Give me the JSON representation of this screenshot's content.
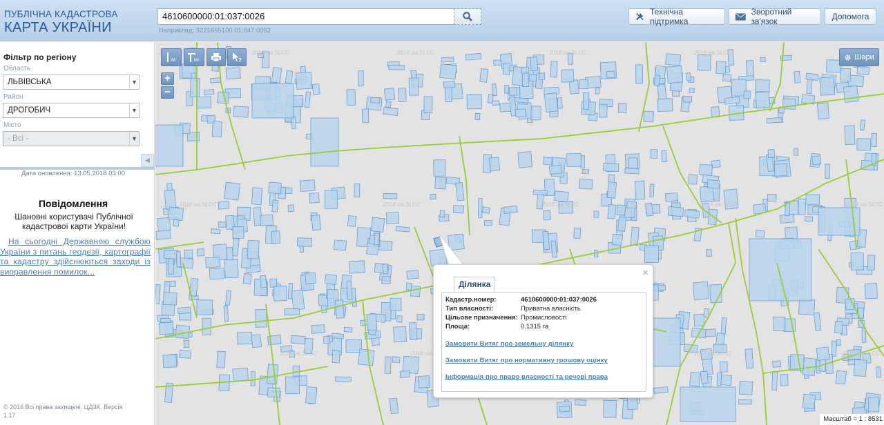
{
  "header": {
    "logo_line1": "ПУБЛІЧНА КАДАСТРОВА",
    "logo_line2": "КАРТА УКРАЇНИ",
    "search_value": "4610600000:01:037:0026",
    "search_example": "Наприклад: 3221655100:01:047:0052",
    "support_label": "Технічна підтримка",
    "feedback_label": "Зворотний зв'язок",
    "help_label": "Допомога"
  },
  "sidebar": {
    "filter_title": "Фільтр по регіону",
    "oblast_label": "Область",
    "oblast_value": "ЛЬВІВСЬКА",
    "rayon_label": "Район",
    "rayon_value": "ДРОГОБИЧ",
    "city_label": "Місто",
    "city_value": "- Всі -",
    "update_date": "Дата оновлення: 13.05.2018 03:00",
    "message_title": "Повідомлення",
    "message_body": "Шановні користувачі Публічної кадастрової карти України!",
    "message_link": "На сьогодні Державною службою України з питань геодезії, картографії та кадастру здійснюються заходи із виправлення помилок...",
    "copyright": "© 2016 Всі права захищені. ЦДЗК. Версія 1.17"
  },
  "map": {
    "layers_label": "Шари",
    "scale_label": "Масштаб = 1 : 8531",
    "watermark": "2018 им.SLCC",
    "colors": {
      "background": "#e3e3e3",
      "parcel_fill": "#b8d4ec",
      "parcel_stroke": "#6aa0d2",
      "boundary": "#9acd32"
    }
  },
  "popup": {
    "tab_label": "Ділянка",
    "rows": [
      {
        "key": "Кадастр.номер:",
        "value": "4610600000:01:037:0026",
        "bold": true
      },
      {
        "key": "Тип власності:",
        "value": "Приватна власність"
      },
      {
        "key": "Цільове призначення:",
        "value": "Промисловості"
      },
      {
        "key": "Площа:",
        "value": "0.1315 га"
      }
    ],
    "link_extract": "Замовити Витяг про земельну ділянку",
    "link_valuation": "Замовити Витяг про нормативну грошову оцінку",
    "link_rights": "Інформація про право власності та речові права"
  }
}
